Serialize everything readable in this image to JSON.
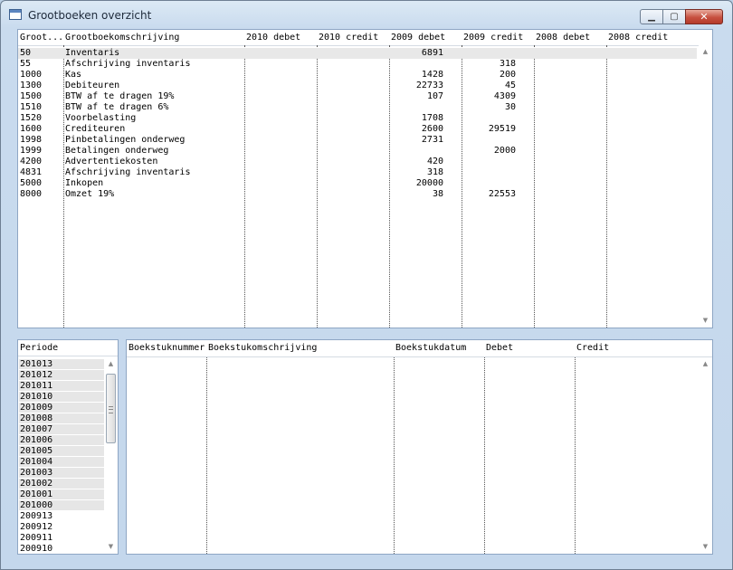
{
  "window": {
    "title": "Grootboeken overzicht",
    "minimize": "▁",
    "maximize": "▢",
    "close": "✕"
  },
  "ledger": {
    "columns": [
      "Groot...",
      "Grootboekomschrijving",
      "2010 debet",
      "2010 credit",
      "2009 debet",
      "2009 credit",
      "2008 debet",
      "2008 credit"
    ],
    "rows": [
      {
        "nr": "50",
        "desc": "Inventaris",
        "d2010": "",
        "c2010": "",
        "d2009": "6891",
        "c2009": "",
        "d2008": "",
        "c2008": ""
      },
      {
        "nr": "55",
        "desc": "Afschrijving inventaris",
        "d2010": "",
        "c2010": "",
        "d2009": "",
        "c2009": "318",
        "d2008": "",
        "c2008": ""
      },
      {
        "nr": "1000",
        "desc": "Kas",
        "d2010": "",
        "c2010": "",
        "d2009": "1428",
        "c2009": "200",
        "d2008": "",
        "c2008": ""
      },
      {
        "nr": "1300",
        "desc": "Debiteuren",
        "d2010": "",
        "c2010": "",
        "d2009": "22733",
        "c2009": "45",
        "d2008": "",
        "c2008": ""
      },
      {
        "nr": "1500",
        "desc": "BTW af te dragen 19%",
        "d2010": "",
        "c2010": "",
        "d2009": "107",
        "c2009": "4309",
        "d2008": "",
        "c2008": ""
      },
      {
        "nr": "1510",
        "desc": "BTW af te dragen 6%",
        "d2010": "",
        "c2010": "",
        "d2009": "",
        "c2009": "30",
        "d2008": "",
        "c2008": ""
      },
      {
        "nr": "1520",
        "desc": "Voorbelasting",
        "d2010": "",
        "c2010": "",
        "d2009": "1708",
        "c2009": "",
        "d2008": "",
        "c2008": ""
      },
      {
        "nr": "1600",
        "desc": "Crediteuren",
        "d2010": "",
        "c2010": "",
        "d2009": "2600",
        "c2009": "29519",
        "d2008": "",
        "c2008": ""
      },
      {
        "nr": "1998",
        "desc": "Pinbetalingen onderweg",
        "d2010": "",
        "c2010": "",
        "d2009": "2731",
        "c2009": "",
        "d2008": "",
        "c2008": ""
      },
      {
        "nr": "1999",
        "desc": "Betalingen onderweg",
        "d2010": "",
        "c2010": "",
        "d2009": "",
        "c2009": "2000",
        "d2008": "",
        "c2008": ""
      },
      {
        "nr": "4200",
        "desc": "Advertentiekosten",
        "d2010": "",
        "c2010": "",
        "d2009": "420",
        "c2009": "",
        "d2008": "",
        "c2008": ""
      },
      {
        "nr": "4831",
        "desc": "Afschrijving inventaris",
        "d2010": "",
        "c2010": "",
        "d2009": "318",
        "c2009": "",
        "d2008": "",
        "c2008": ""
      },
      {
        "nr": "5000",
        "desc": "Inkopen",
        "d2010": "",
        "c2010": "",
        "d2009": "20000",
        "c2009": "",
        "d2008": "",
        "c2008": ""
      },
      {
        "nr": "8000",
        "desc": "Omzet 19%",
        "d2010": "",
        "c2010": "",
        "d2009": "38",
        "c2009": "22553",
        "d2008": "",
        "c2008": ""
      }
    ],
    "selected_row": "50"
  },
  "periods": {
    "header": "Periode",
    "items": [
      "201013",
      "201012",
      "201011",
      "201010",
      "201009",
      "201008",
      "201007",
      "201006",
      "201005",
      "201004",
      "201003",
      "201002",
      "201001",
      "201000",
      "200913",
      "200912",
      "200911",
      "200910"
    ],
    "shaded_count": 14
  },
  "entries": {
    "columns": [
      "Boekstuknummer",
      "Boekstukomschrijving",
      "Boekstukdatum",
      "Debet",
      "Credit"
    ],
    "rows": []
  },
  "icons": {
    "scroll_up": "▲",
    "scroll_down": "▼"
  }
}
